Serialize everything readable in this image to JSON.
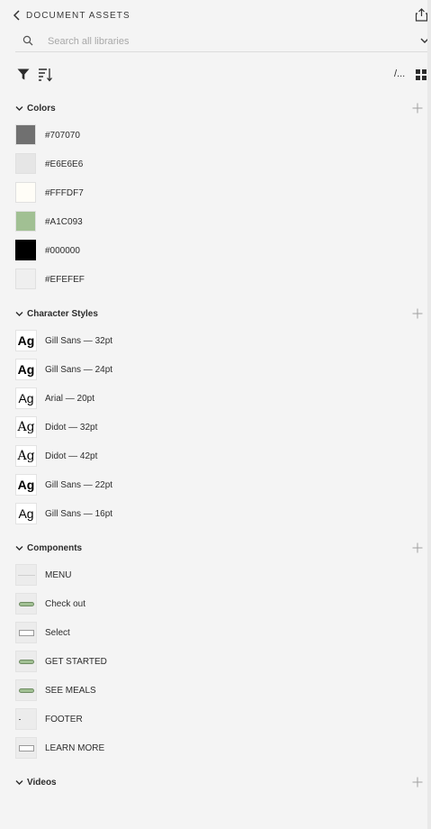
{
  "header": {
    "title": "DOCUMENT ASSETS"
  },
  "search": {
    "placeholder": "Search all libraries"
  },
  "toolbar": {
    "path_view_label": "/..."
  },
  "colors": {
    "title": "Colors",
    "items": [
      {
        "hex": "#707070",
        "label": "#707070"
      },
      {
        "hex": "#E6E6E6",
        "label": "#E6E6E6"
      },
      {
        "hex": "#FFFDF7",
        "label": "#FFFDF7"
      },
      {
        "hex": "#A1C093",
        "label": "#A1C093"
      },
      {
        "hex": "#000000",
        "label": "#000000"
      },
      {
        "hex": "#EFEFEF",
        "label": "#EFEFEF"
      }
    ]
  },
  "character_styles": {
    "title": "Character Styles",
    "preview": "Ag",
    "items": [
      {
        "label": "Gill Sans — 32pt",
        "style": "bold"
      },
      {
        "label": "Gill Sans — 24pt",
        "style": "bold"
      },
      {
        "label": "Arial — 20pt",
        "style": "regular"
      },
      {
        "label": "Didot — 32pt",
        "style": "serif"
      },
      {
        "label": "Didot — 42pt",
        "style": "serif"
      },
      {
        "label": "Gill Sans — 22pt",
        "style": "bold"
      },
      {
        "label": "Gill Sans — 16pt",
        "style": "regular"
      }
    ]
  },
  "components": {
    "title": "Components",
    "items": [
      {
        "label": "MENU",
        "thumb": "line"
      },
      {
        "label": "Check out",
        "thumb": "pill"
      },
      {
        "label": "Select",
        "thumb": "box"
      },
      {
        "label": "GET STARTED",
        "thumb": "pill"
      },
      {
        "label": "SEE MEALS",
        "thumb": "pill"
      },
      {
        "label": "FOOTER",
        "thumb": "dot"
      },
      {
        "label": "LEARN MORE",
        "thumb": "box"
      }
    ]
  },
  "videos": {
    "title": "Videos"
  }
}
